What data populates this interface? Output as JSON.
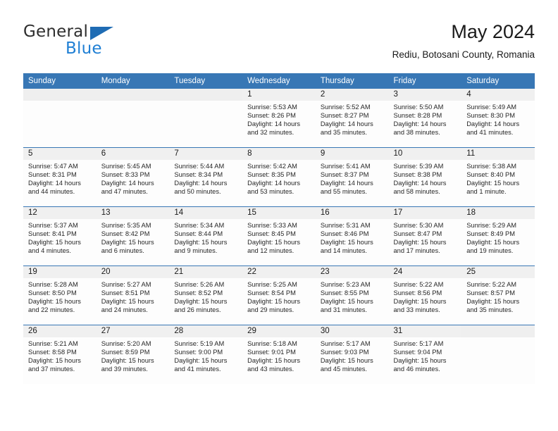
{
  "brand": {
    "name_part1": "General",
    "name_part2": "Blue",
    "triangle_icon": "triangle-icon",
    "colors": {
      "general_text": "#2e2e2e",
      "blue_text": "#1f7fd4",
      "triangle": "#1f6cb4"
    }
  },
  "header": {
    "title": "May 2024",
    "subtitle": "Rediu, Botosani County, Romania"
  },
  "calendar": {
    "accent_color": "#3877b5",
    "daynum_band_color": "#f0f0f0",
    "weekday_headers": [
      "Sunday",
      "Monday",
      "Tuesday",
      "Wednesday",
      "Thursday",
      "Friday",
      "Saturday"
    ],
    "weeks": [
      [
        {
          "day": "",
          "info": ""
        },
        {
          "day": "",
          "info": ""
        },
        {
          "day": "",
          "info": ""
        },
        {
          "day": "1",
          "info": "Sunrise: 5:53 AM\nSunset: 8:26 PM\nDaylight: 14 hours\nand 32 minutes."
        },
        {
          "day": "2",
          "info": "Sunrise: 5:52 AM\nSunset: 8:27 PM\nDaylight: 14 hours\nand 35 minutes."
        },
        {
          "day": "3",
          "info": "Sunrise: 5:50 AM\nSunset: 8:28 PM\nDaylight: 14 hours\nand 38 minutes."
        },
        {
          "day": "4",
          "info": "Sunrise: 5:49 AM\nSunset: 8:30 PM\nDaylight: 14 hours\nand 41 minutes."
        }
      ],
      [
        {
          "day": "5",
          "info": "Sunrise: 5:47 AM\nSunset: 8:31 PM\nDaylight: 14 hours\nand 44 minutes."
        },
        {
          "day": "6",
          "info": "Sunrise: 5:45 AM\nSunset: 8:33 PM\nDaylight: 14 hours\nand 47 minutes."
        },
        {
          "day": "7",
          "info": "Sunrise: 5:44 AM\nSunset: 8:34 PM\nDaylight: 14 hours\nand 50 minutes."
        },
        {
          "day": "8",
          "info": "Sunrise: 5:42 AM\nSunset: 8:35 PM\nDaylight: 14 hours\nand 53 minutes."
        },
        {
          "day": "9",
          "info": "Sunrise: 5:41 AM\nSunset: 8:37 PM\nDaylight: 14 hours\nand 55 minutes."
        },
        {
          "day": "10",
          "info": "Sunrise: 5:39 AM\nSunset: 8:38 PM\nDaylight: 14 hours\nand 58 minutes."
        },
        {
          "day": "11",
          "info": "Sunrise: 5:38 AM\nSunset: 8:40 PM\nDaylight: 15 hours\nand 1 minute."
        }
      ],
      [
        {
          "day": "12",
          "info": "Sunrise: 5:37 AM\nSunset: 8:41 PM\nDaylight: 15 hours\nand 4 minutes."
        },
        {
          "day": "13",
          "info": "Sunrise: 5:35 AM\nSunset: 8:42 PM\nDaylight: 15 hours\nand 6 minutes."
        },
        {
          "day": "14",
          "info": "Sunrise: 5:34 AM\nSunset: 8:44 PM\nDaylight: 15 hours\nand 9 minutes."
        },
        {
          "day": "15",
          "info": "Sunrise: 5:33 AM\nSunset: 8:45 PM\nDaylight: 15 hours\nand 12 minutes."
        },
        {
          "day": "16",
          "info": "Sunrise: 5:31 AM\nSunset: 8:46 PM\nDaylight: 15 hours\nand 14 minutes."
        },
        {
          "day": "17",
          "info": "Sunrise: 5:30 AM\nSunset: 8:47 PM\nDaylight: 15 hours\nand 17 minutes."
        },
        {
          "day": "18",
          "info": "Sunrise: 5:29 AM\nSunset: 8:49 PM\nDaylight: 15 hours\nand 19 minutes."
        }
      ],
      [
        {
          "day": "19",
          "info": "Sunrise: 5:28 AM\nSunset: 8:50 PM\nDaylight: 15 hours\nand 22 minutes."
        },
        {
          "day": "20",
          "info": "Sunrise: 5:27 AM\nSunset: 8:51 PM\nDaylight: 15 hours\nand 24 minutes."
        },
        {
          "day": "21",
          "info": "Sunrise: 5:26 AM\nSunset: 8:52 PM\nDaylight: 15 hours\nand 26 minutes."
        },
        {
          "day": "22",
          "info": "Sunrise: 5:25 AM\nSunset: 8:54 PM\nDaylight: 15 hours\nand 29 minutes."
        },
        {
          "day": "23",
          "info": "Sunrise: 5:23 AM\nSunset: 8:55 PM\nDaylight: 15 hours\nand 31 minutes."
        },
        {
          "day": "24",
          "info": "Sunrise: 5:22 AM\nSunset: 8:56 PM\nDaylight: 15 hours\nand 33 minutes."
        },
        {
          "day": "25",
          "info": "Sunrise: 5:22 AM\nSunset: 8:57 PM\nDaylight: 15 hours\nand 35 minutes."
        }
      ],
      [
        {
          "day": "26",
          "info": "Sunrise: 5:21 AM\nSunset: 8:58 PM\nDaylight: 15 hours\nand 37 minutes."
        },
        {
          "day": "27",
          "info": "Sunrise: 5:20 AM\nSunset: 8:59 PM\nDaylight: 15 hours\nand 39 minutes."
        },
        {
          "day": "28",
          "info": "Sunrise: 5:19 AM\nSunset: 9:00 PM\nDaylight: 15 hours\nand 41 minutes."
        },
        {
          "day": "29",
          "info": "Sunrise: 5:18 AM\nSunset: 9:01 PM\nDaylight: 15 hours\nand 43 minutes."
        },
        {
          "day": "30",
          "info": "Sunrise: 5:17 AM\nSunset: 9:03 PM\nDaylight: 15 hours\nand 45 minutes."
        },
        {
          "day": "31",
          "info": "Sunrise: 5:17 AM\nSunset: 9:04 PM\nDaylight: 15 hours\nand 46 minutes."
        },
        {
          "day": "",
          "info": ""
        }
      ]
    ]
  }
}
